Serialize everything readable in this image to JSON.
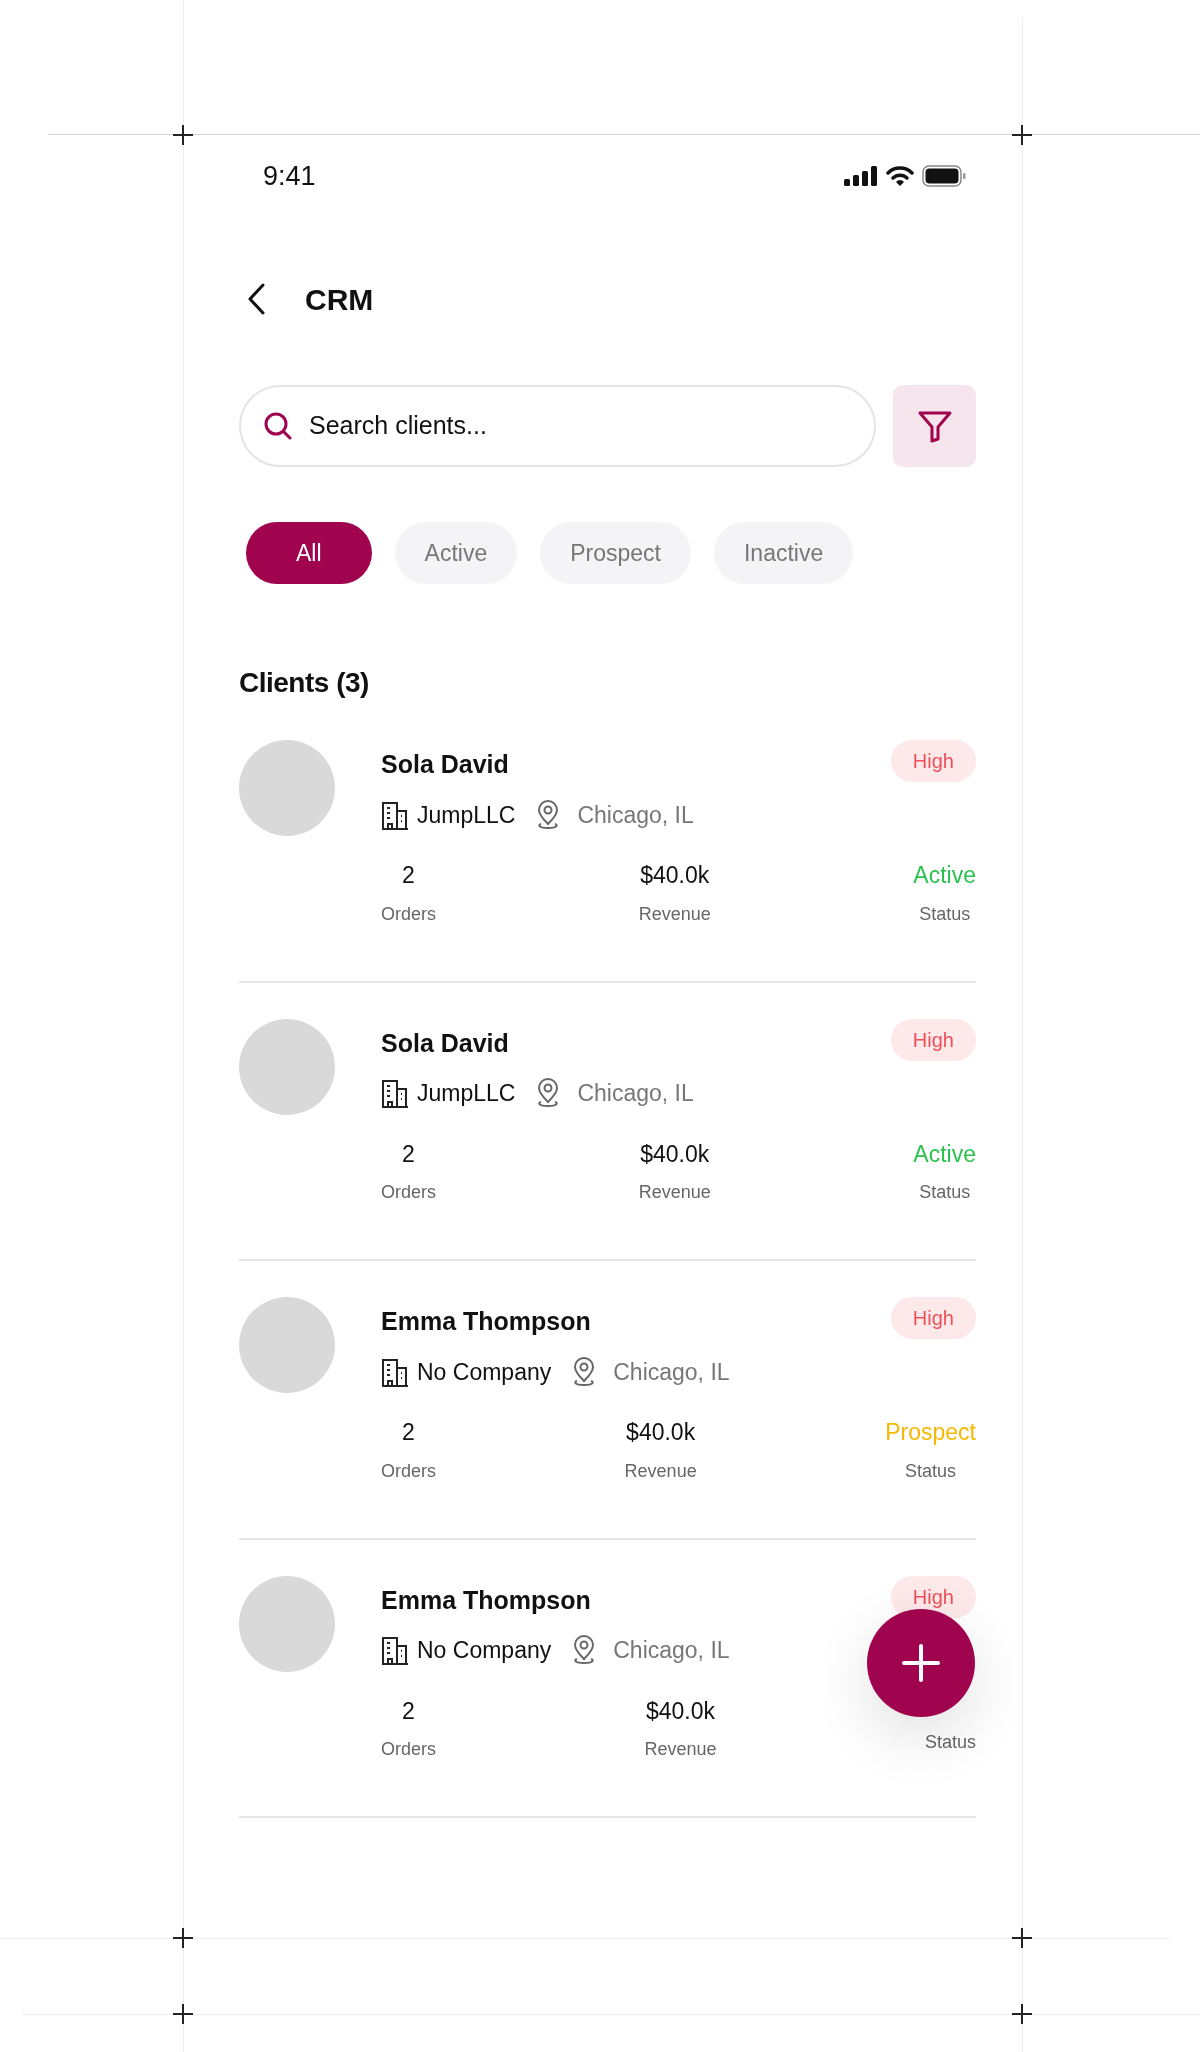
{
  "status_bar": {
    "time": "9:41"
  },
  "header": {
    "title": "CRM"
  },
  "search": {
    "placeholder": "Search clients..."
  },
  "filters": [
    {
      "label": "All",
      "selected": true
    },
    {
      "label": "Active",
      "selected": false
    },
    {
      "label": "Prospect",
      "selected": false
    },
    {
      "label": "Inactive",
      "selected": false
    }
  ],
  "section_title": "Clients (3)",
  "clients": [
    {
      "name": "Sola David",
      "priority": "High",
      "company": "JumpLLC",
      "location": "Chicago, IL",
      "orders": "2",
      "orders_label": "Orders",
      "revenue": "$40.0k",
      "revenue_label": "Revenue",
      "status": "Active",
      "color": "#2cc24f",
      "status_label": "Status"
    },
    {
      "name": "Sola David",
      "priority": "High",
      "company": "JumpLLC",
      "location": "Chicago, IL",
      "orders": "2",
      "orders_label": "Orders",
      "revenue": "$40.0k",
      "revenue_label": "Revenue",
      "status": "Active",
      "color": "#2cc24f",
      "status_label": "Status"
    },
    {
      "name": "Emma Thompson",
      "priority": "High",
      "company": "No Company",
      "location": "Chicago, IL",
      "orders": "2",
      "orders_label": "Orders",
      "revenue": "$40.0k",
      "revenue_label": "Revenue",
      "status": "Prospect",
      "color": "#f5b800",
      "status_label": "Status"
    },
    {
      "name": "Emma Thompson",
      "priority": "High",
      "company": "No Company",
      "location": "Chicago, IL",
      "orders": "2",
      "orders_label": "Orders",
      "revenue": "$40.0k",
      "revenue_label": "Revenue",
      "status_label": "Status"
    }
  ]
}
